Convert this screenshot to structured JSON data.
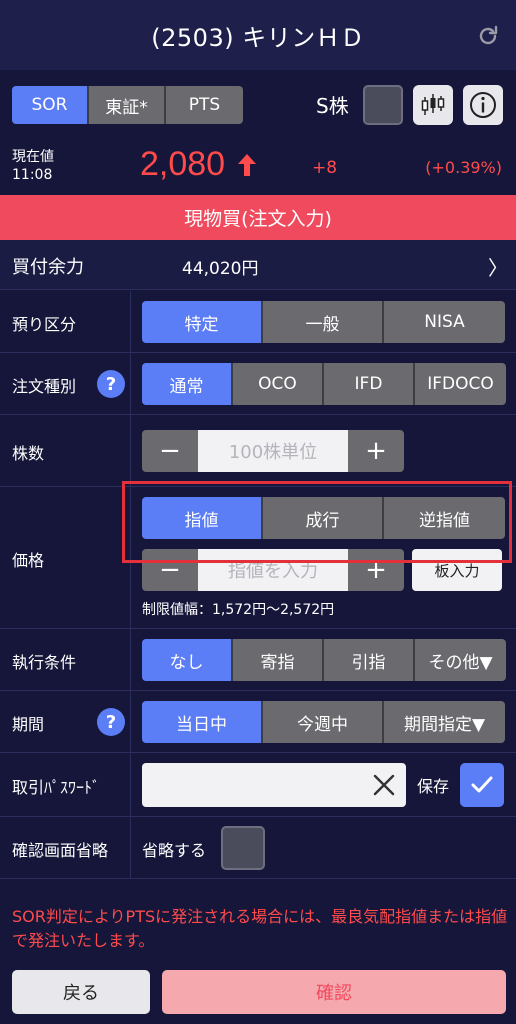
{
  "header": {
    "title": "(2503) キリンＨＤ"
  },
  "market": {
    "options": [
      "SOR",
      "東証*",
      "PTS"
    ],
    "selected": "SOR"
  },
  "s_kabu": {
    "label": "S株",
    "checked": false
  },
  "quote": {
    "label_current": "現在値",
    "time": "11:08",
    "price": "2,080",
    "change": "+8",
    "change_pct": "(+0.39%)",
    "up_color": "#ff4b4b"
  },
  "banner": {
    "title": "現物買(注文入力)",
    "color": "#f04a5e"
  },
  "buying_power": {
    "label": "買付余力",
    "value": "44,020円",
    "chevron": "〉"
  },
  "deposit": {
    "label": "預り区分",
    "options": [
      "特定",
      "一般",
      "NISA"
    ],
    "selected": "特定"
  },
  "order_type": {
    "label": "注文種別",
    "help": "?",
    "options": [
      "通常",
      "OCO",
      "IFD",
      "IFDOCO"
    ],
    "selected": "通常"
  },
  "quantity": {
    "label": "株数",
    "minus": "−",
    "plus": "+",
    "placeholder": "100株単位",
    "value": ""
  },
  "price": {
    "label": "価格",
    "options": [
      "指値",
      "成行",
      "逆指値"
    ],
    "selected": "指値",
    "minus": "−",
    "plus": "+",
    "placeholder": "指値を入力",
    "value": "",
    "board_button": "板入力",
    "limit_range": "制限値幅：1,572円〜2,572円"
  },
  "execution": {
    "label": "執行条件",
    "options": [
      "なし",
      "寄指",
      "引指",
      "その他▼"
    ],
    "selected": "なし"
  },
  "period": {
    "label": "期間",
    "help": "?",
    "options": [
      "当日中",
      "今週中",
      "期間指定▼"
    ],
    "selected": "当日中"
  },
  "password": {
    "label": "取引ﾊﾟｽﾜｰﾄﾞ",
    "value": "",
    "save_label": "保存",
    "save_checked": true
  },
  "skip_confirm": {
    "label": "確認画面省略",
    "option_label": "省略する",
    "checked": false
  },
  "notice": "SOR判定によりPTSに発注される場合には、最良気配指値または指値で発注いたします。",
  "actions": {
    "back": "戻る",
    "confirm": "確認"
  },
  "accent_color": "#5b7df5"
}
